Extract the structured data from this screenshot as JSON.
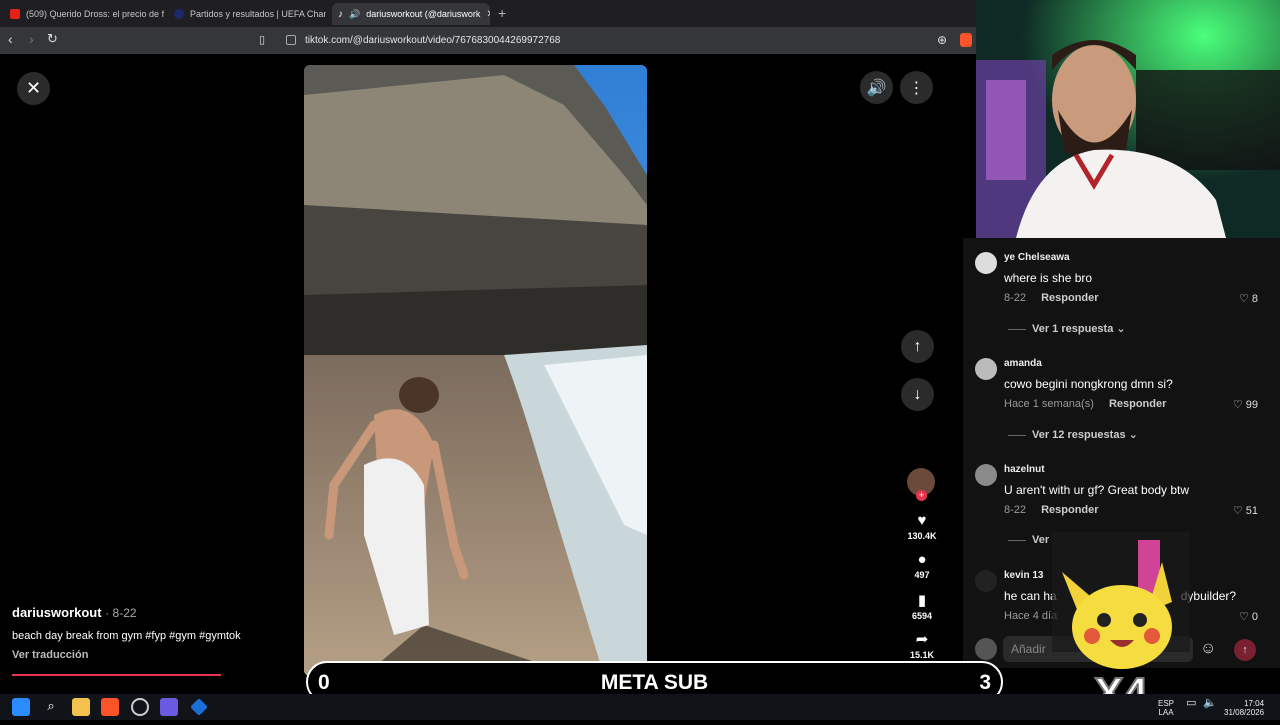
{
  "browser": {
    "tabs": [
      {
        "title": "(509) Querido Dross: el precio de fam",
        "active": false
      },
      {
        "title": "Partidos y resultados | UEFA Champi",
        "active": false
      },
      {
        "title": "dariusworkout (@dariuswork",
        "active": true
      }
    ],
    "new_tab": "+",
    "url": "tiktok.com/@dariusworkout/video/7676830044269972768"
  },
  "video": {
    "username": "dariusworkout",
    "date": "· 8-22",
    "description": "beach day break from gym #fyp #gym #gymtok",
    "translate": "Ver traducción",
    "progress": 0.22,
    "actions": {
      "likes": "130.4K",
      "comments": "497",
      "saves": "6594",
      "shares": "15.1K"
    }
  },
  "comments": [
    {
      "user": "ye Chelseawa",
      "text": "where is she bro",
      "time": "8-22",
      "reply": "Responder",
      "likes": "8",
      "more": "Ver 1 respuesta"
    },
    {
      "user": "amanda",
      "text": "cowo begini nongkrong dmn si?",
      "time": "Hace 1 semana(s)",
      "reply": "Responder",
      "likes": "99",
      "more": "Ver 12 respuestas"
    },
    {
      "user": "hazelnut",
      "text": "U aren't with ur gf? Great body btw",
      "time": "8-22",
      "reply": "Responder",
      "likes": "51",
      "more": "Ver"
    },
    {
      "user": "kevin 13",
      "text": "he can ha",
      "text_tail": "dybuilder?",
      "time": "Hace 4 día",
      "reply": "",
      "likes": "0",
      "more": ""
    }
  ],
  "comment_input": {
    "placeholder": "Añadir"
  },
  "overlay": {
    "left_count": "0",
    "title": "META SUB",
    "right_count": "3",
    "sticker_text": "X4"
  },
  "taskbar": {
    "lang": "ESP",
    "lang2": "LAA",
    "time": "17:04",
    "date": "31/08/2026"
  },
  "colors": {
    "tiktok_red": "#e8344f",
    "panel_bg": "#121212",
    "chrome_bg": "#35363a"
  }
}
